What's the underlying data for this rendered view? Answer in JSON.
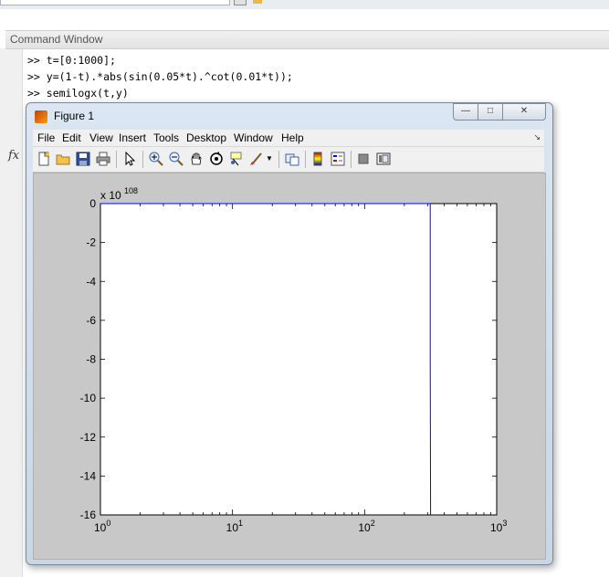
{
  "command_window": {
    "title": "Command Window",
    "fx_label": "fx",
    "lines": [
      ">> t=[0:1000];",
      ">> y=(1-t).*abs(sin(0.05*t).^cot(0.01*t));",
      ">> semilogx(t,y)"
    ]
  },
  "figure": {
    "title": "Figure 1",
    "menus": [
      "File",
      "Edit",
      "View",
      "Insert",
      "Tools",
      "Desktop",
      "Window",
      "Help"
    ],
    "toolbar_icons": [
      "new-figure-icon",
      "open-file-icon",
      "save-icon",
      "print-icon",
      "pointer-icon",
      "zoom-in-icon",
      "zoom-out-icon",
      "pan-icon",
      "rotate-3d-icon",
      "data-cursor-icon",
      "brush-icon",
      "brush-dropdown-icon",
      "link-plot-icon",
      "colorbar-icon",
      "legend-icon",
      "hide-plot-tools-icon",
      "show-plot-tools-icon"
    ]
  },
  "chart_data": {
    "type": "line",
    "xscale": "log",
    "xlim": [
      1,
      1000
    ],
    "ylim": [
      -16,
      0
    ],
    "exponent_label": "x 10^108",
    "exponent_base": "x 10",
    "exponent_power": "108",
    "x_ticks": [
      {
        "base": "10",
        "power": "0",
        "value": 1
      },
      {
        "base": "10",
        "power": "1",
        "value": 10
      },
      {
        "base": "10",
        "power": "2",
        "value": 100
      },
      {
        "base": "10",
        "power": "3",
        "value": 1000
      }
    ],
    "y_ticks": [
      0,
      -2,
      -4,
      -6,
      -8,
      -10,
      -12,
      -14,
      -16
    ],
    "series": [
      {
        "color": "#0000ff",
        "x": [
          1,
          300,
          314,
          314,
          316
        ],
        "y": [
          0,
          0,
          0,
          -8,
          -16
        ]
      }
    ]
  }
}
